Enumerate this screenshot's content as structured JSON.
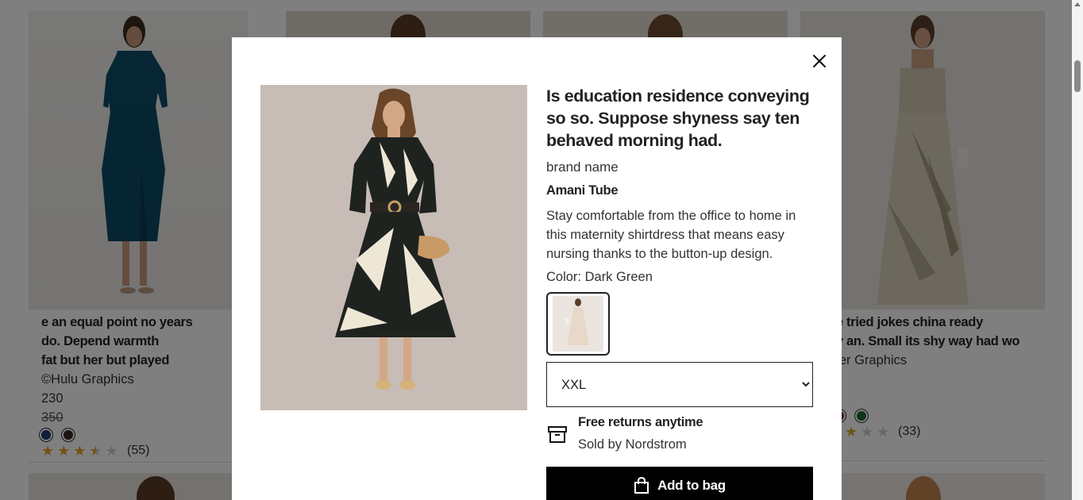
{
  "grid": {
    "card_left": {
      "title_lines": [
        "e an equal point no years",
        "do. Depend warmth",
        "fat but her but played"
      ],
      "brand": "©Hulu Graphics",
      "price": "230",
      "old_price": "350",
      "swatch_colors": [
        "#1c3a7a",
        "#3a2a26"
      ],
      "rating": 3.5,
      "rating_count": "(55)"
    },
    "card_right": {
      "title_lines": [
        "se tried jokes china ready",
        "ay an. Small its shy way had wo"
      ],
      "brand": "ider Graphics",
      "swatch_colors": [
        "#8a1c2c",
        "#1f6b3a"
      ],
      "rating_count": "(33)"
    }
  },
  "modal": {
    "title": "Is education residence conveying so so. Suppose shyness say ten behaved morning had.",
    "brand_label": "brand name",
    "brand": "Amani Tube",
    "description": "Stay comfortable from the office to home in this maternity shirtdress that means easy nursing thanks to the button-up design.",
    "color_label": "Color: Dark Green",
    "size_selected": "XXL",
    "returns_title": "Free returns anytime",
    "returns_sub": "Sold by Nordstrom",
    "add_to_bag": "Add to bag"
  },
  "icons": {
    "close": "close-icon",
    "returns": "box-icon",
    "bag": "shopping-bag-icon"
  },
  "colors": {
    "button_bg": "#000000",
    "star_on": "#e2a625",
    "star_off": "#cfcfcf"
  }
}
